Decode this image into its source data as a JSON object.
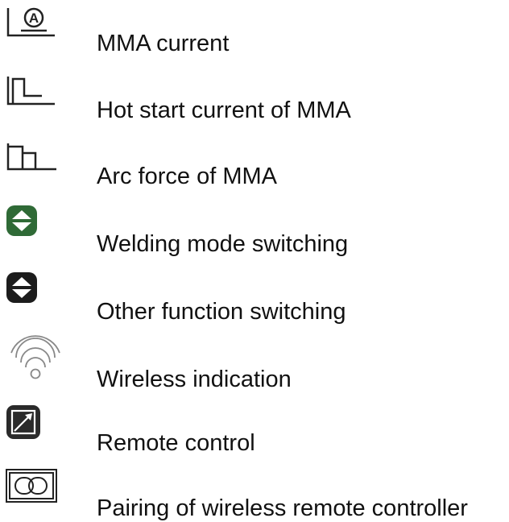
{
  "colors": {
    "text": "#111111",
    "icon_stroke": "#222222",
    "mode_switch_fill": "#2f6a36",
    "function_switch_fill": "#1c1c1c",
    "remote_fill": "#2a2a2a",
    "wireless_stroke": "#888888"
  },
  "legend": {
    "items": [
      {
        "icon": "mma-current-icon",
        "icon_glyph": "A",
        "label": "MMA current"
      },
      {
        "icon": "hot-start-current-icon",
        "label": "Hot start current of MMA"
      },
      {
        "icon": "arc-force-icon",
        "label": "Arc force of MMA"
      },
      {
        "icon": "welding-mode-switch-icon",
        "label": "Welding mode switching"
      },
      {
        "icon": "other-function-switch-icon",
        "label": "Other function switching"
      },
      {
        "icon": "wireless-indication-icon",
        "label": "Wireless indication"
      },
      {
        "icon": "remote-control-icon",
        "label": "Remote control"
      },
      {
        "icon": "pairing-icon",
        "label": "Pairing of wireless remote controller"
      }
    ]
  }
}
